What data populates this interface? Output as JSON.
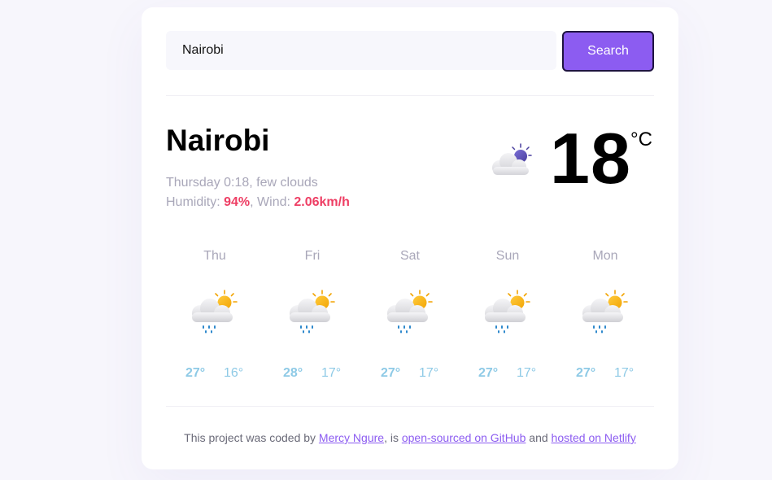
{
  "search": {
    "value": "Nairobi",
    "button_label": "Search"
  },
  "current": {
    "city": "Nairobi",
    "datetime_label": "Thursday 0:18",
    "separator": ", ",
    "description": "few clouds",
    "humidity_label": "Humidity: ",
    "humidity_value": "94%",
    "wind_label": ", Wind: ",
    "wind_value": "2.06km/h",
    "temperature": "18",
    "unit": "°C",
    "icon": "few-clouds-night-icon"
  },
  "forecast": [
    {
      "day": "Thu",
      "max": "27°",
      "min": "16°",
      "icon": "rain-sun-cloud-icon"
    },
    {
      "day": "Fri",
      "max": "28°",
      "min": "17°",
      "icon": "rain-sun-cloud-icon"
    },
    {
      "day": "Sat",
      "max": "27°",
      "min": "17°",
      "icon": "rain-sun-cloud-icon"
    },
    {
      "day": "Sun",
      "max": "27°",
      "min": "17°",
      "icon": "rain-sun-cloud-icon"
    },
    {
      "day": "Mon",
      "max": "27°",
      "min": "17°",
      "icon": "rain-sun-cloud-icon"
    }
  ],
  "footer": {
    "text1": "This project was coded by ",
    "author_link": "Mercy Ngure",
    "text2": ", is ",
    "github_link": "open-sourced on GitHub",
    "text3": " and ",
    "netlify_link": "hosted on Netlify"
  },
  "colors": {
    "accent": "#8c5cf1",
    "highlight": "#ee3e64",
    "forecast_temp": "#8ecae6",
    "muted": "#a9a7b9"
  }
}
